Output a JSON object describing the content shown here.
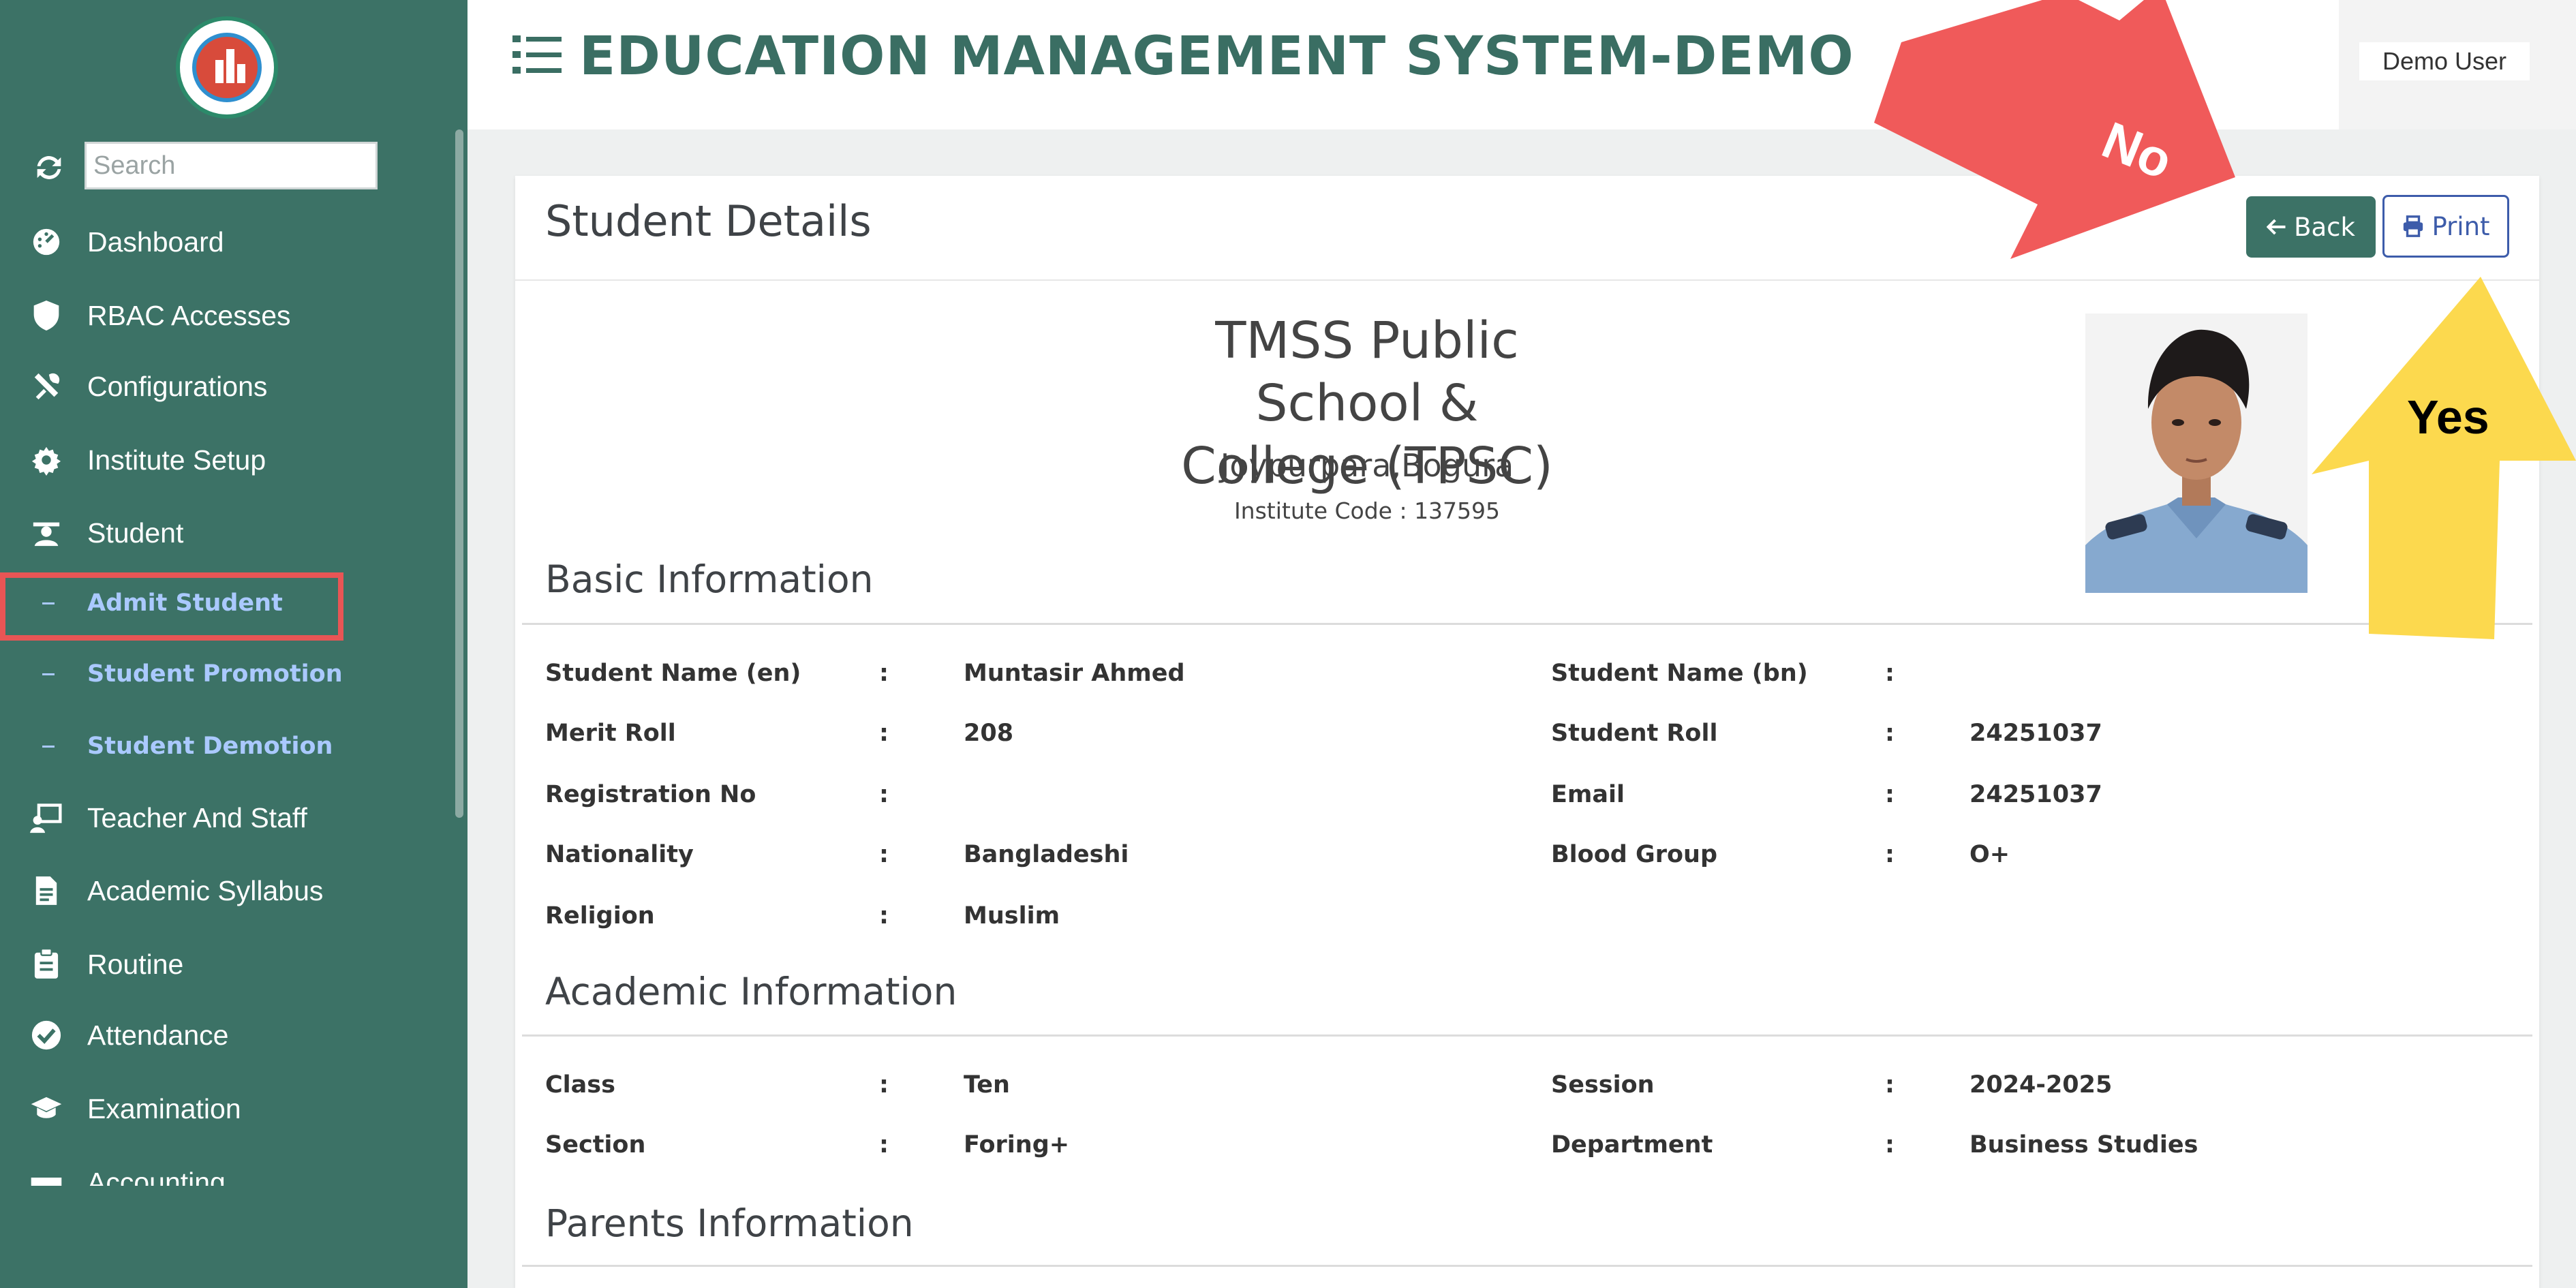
{
  "app": {
    "title": "EDUCATION MANAGEMENT SYSTEM-DEMO",
    "user": "Demo User"
  },
  "sidebar": {
    "search_placeholder": "Search",
    "items": [
      {
        "label": "Dashboard",
        "icon": "dashboard-icon"
      },
      {
        "label": "RBAC Accesses",
        "icon": "shield-icon"
      },
      {
        "label": "Configurations",
        "icon": "tools-icon"
      },
      {
        "label": "Institute Setup",
        "icon": "gear-icon"
      },
      {
        "label": "Student",
        "icon": "student-icon"
      },
      {
        "label": "Teacher And Staff",
        "icon": "teacher-icon"
      },
      {
        "label": "Academic Syllabus",
        "icon": "document-icon"
      },
      {
        "label": "Routine",
        "icon": "clipboard-icon"
      },
      {
        "label": "Attendance",
        "icon": "check-circle-icon"
      },
      {
        "label": "Examination",
        "icon": "graduation-cap-icon"
      },
      {
        "label": "Accounting",
        "icon": "accounting-icon"
      }
    ],
    "student_sub": [
      {
        "label": "Admit Student"
      },
      {
        "label": "Student Promotion"
      },
      {
        "label": "Student Demotion"
      }
    ]
  },
  "page": {
    "title": "Student Details",
    "back_label": "Back",
    "print_label": "Print",
    "school": {
      "name_line1": "TMSS Public School &",
      "name_line2": "College (TPSC)",
      "address": "Joypurpara,Bogura",
      "code": "Institute Code : 137595"
    },
    "sections": {
      "basic": "Basic Information",
      "academic": "Academic Information",
      "parents": "Parents Information"
    },
    "separator": ":",
    "basic_left": [
      {
        "label": "Student Name (en)",
        "value": "Muntasir Ahmed"
      },
      {
        "label": "Merit Roll",
        "value": "208"
      },
      {
        "label": "Registration No",
        "value": ""
      },
      {
        "label": "Nationality",
        "value": "Bangladeshi"
      },
      {
        "label": "Religion",
        "value": "Muslim"
      }
    ],
    "basic_right": [
      {
        "label": "Student Name (bn)",
        "value": ""
      },
      {
        "label": "Student Roll",
        "value": "24251037"
      },
      {
        "label": "Email",
        "value": "24251037"
      },
      {
        "label": "Blood Group",
        "value": "O+"
      }
    ],
    "academic_left": [
      {
        "label": "Class",
        "value": "Ten"
      },
      {
        "label": "Section",
        "value": "Foring+"
      }
    ],
    "academic_right": [
      {
        "label": "Session",
        "value": "2024-2025"
      },
      {
        "label": "Department",
        "value": "Business Studies"
      }
    ]
  },
  "annotations": {
    "no_label": "No",
    "yes_label": "Yes",
    "no_color": "#f05a5a",
    "yes_color": "#fcd94e"
  },
  "colors": {
    "sidebar_bg": "#3c7266",
    "accent": "#3c7266",
    "print_blue": "#3d5caa",
    "highlight_red": "#e85555"
  }
}
